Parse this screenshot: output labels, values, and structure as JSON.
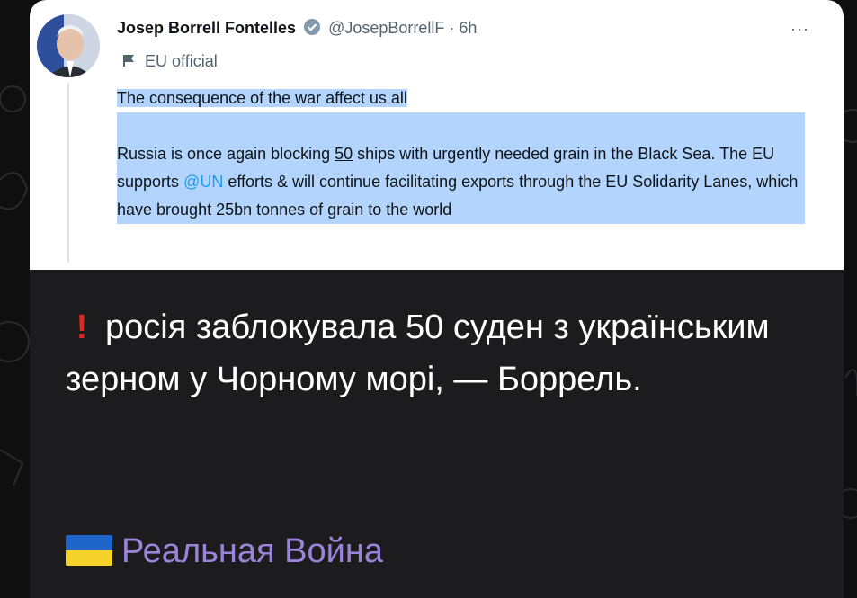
{
  "tweet": {
    "author_name": "Josep Borrell Fontelles",
    "handle_time": "@JosepBorrellF · 6h",
    "more": "···",
    "label": "EU official",
    "line1": "The consequence of the war affect us all",
    "p2_a": "Russia is once again blocking ",
    "p2_num": "50",
    "p2_b": " ships with urgently needed grain in the Black Sea. The EU supports ",
    "mention": "@UN",
    "p2_c": " efforts & will continue facilitating exports through the EU Solidarity Lanes, which have brought 25bn tonnes of grain to the world"
  },
  "message": {
    "warning_glyph": "!",
    "text": "росія заблокувала 50 суден з українським зерном у Чорному морі, — Боррель."
  },
  "channel": {
    "name": "Реальная Война"
  },
  "colors": {
    "accent": "#9a83d8",
    "selection": "#b3d4fc",
    "warning": "#e0281f",
    "mention": "#1d9bf0"
  },
  "icons": [
    "verified-badge-icon",
    "more-options-icon",
    "flag-icon",
    "exclamation-icon",
    "ukraine-flag-icon"
  ]
}
